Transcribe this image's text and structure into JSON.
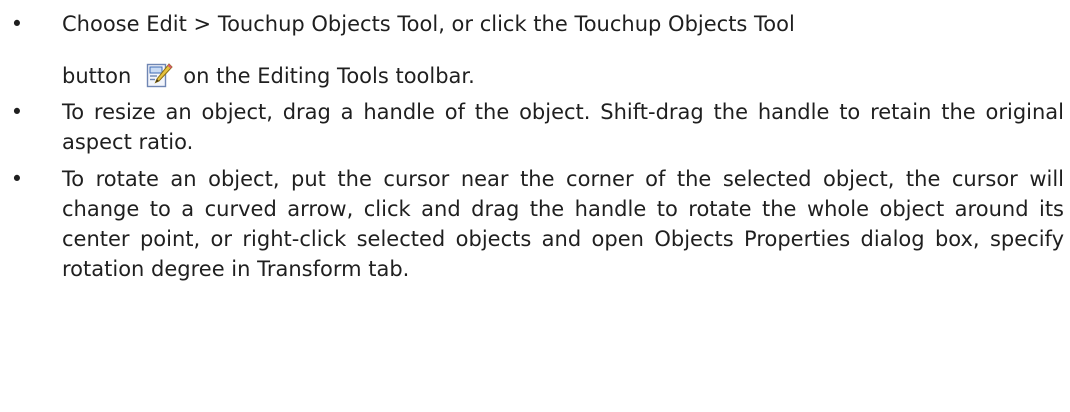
{
  "items": [
    {
      "bullet": "•",
      "line1": "Choose Edit > Touchup Objects Tool, or click the Touchup Objects Tool",
      "line2_before": "button",
      "icon": "touchup-objects-tool-icon",
      "line2_after": "on the Editing Tools toolbar."
    },
    {
      "bullet": "•",
      "text": "To resize an object, drag a handle of the object. Shift-drag the handle to retain the original aspect ratio."
    },
    {
      "bullet": "•",
      "text": "To rotate an object, put the cursor near the corner of the selected object, the cursor will change to a curved arrow, click and drag the handle to rotate the whole object around its center point, or right-click selected objects and open Objects Properties dialog box, specify rotation degree in Transform tab."
    }
  ]
}
